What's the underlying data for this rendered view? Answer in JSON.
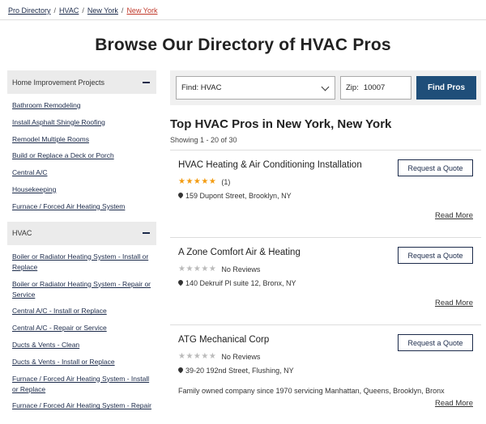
{
  "breadcrumb": [
    "Pro Directory",
    "HVAC",
    "New York",
    "New York"
  ],
  "page_title": "Browse Our Directory of HVAC Pros",
  "sidebar": {
    "groups": [
      {
        "title": "Home Improvement Projects",
        "items": [
          "Bathroom Remodeling",
          "Install Asphalt Shingle Roofing",
          "Remodel Multiple Rooms",
          "Build or Replace a Deck or Porch",
          "Central A/C",
          "Housekeeping",
          "Furnace / Forced Air Heating System"
        ]
      },
      {
        "title": "HVAC",
        "items": [
          "Boiler or Radiator Heating System - Install or Replace",
          "Boiler or Radiator Heating System - Repair or Service",
          "Central A/C - Install or Replace",
          "Central A/C - Repair or Service",
          "Ducts & Vents - Clean",
          "Ducts & Vents - Install or Replace",
          "Furnace / Forced Air Heating System - Install or Replace",
          "Furnace / Forced Air Heating System - Repair"
        ]
      }
    ]
  },
  "search": {
    "find_value": "Find: HVAC",
    "zip_label": "Zip:",
    "zip_value": "10007",
    "button_label": "Find Pros"
  },
  "results": {
    "title": "Top HVAC Pros in New York, New York",
    "count": "Showing 1 - 20 of 30",
    "quote_label": "Request a Quote",
    "read_more_label": "Read More",
    "listings": [
      {
        "name": "HVAC Heating & Air Conditioning Installation",
        "stars": "★★★★★",
        "reviews": "(1)",
        "address": "159 Dupont Street, Brooklyn, NY",
        "description": ""
      },
      {
        "name": "A Zone Comfort Air & Heating",
        "stars": "★★★★★",
        "reviews": "No Reviews",
        "address": "140 Dekruif Pl suite 12, Bronx, NY",
        "description": ""
      },
      {
        "name": "ATG Mechanical Corp",
        "stars": "★★★★★",
        "reviews": "No Reviews",
        "address": "39-20 192nd Street, Flushing, NY",
        "description": "Family owned company since 1970 servicing Manhattan, Queens, Brooklyn, Bronx"
      }
    ]
  },
  "colors": {
    "primary_button": "#1f4e79",
    "link": "#1b2a4a",
    "breadcrumb_current": "#c0392b",
    "star_filled": "#f39c12",
    "star_empty": "#bbbbbb"
  }
}
